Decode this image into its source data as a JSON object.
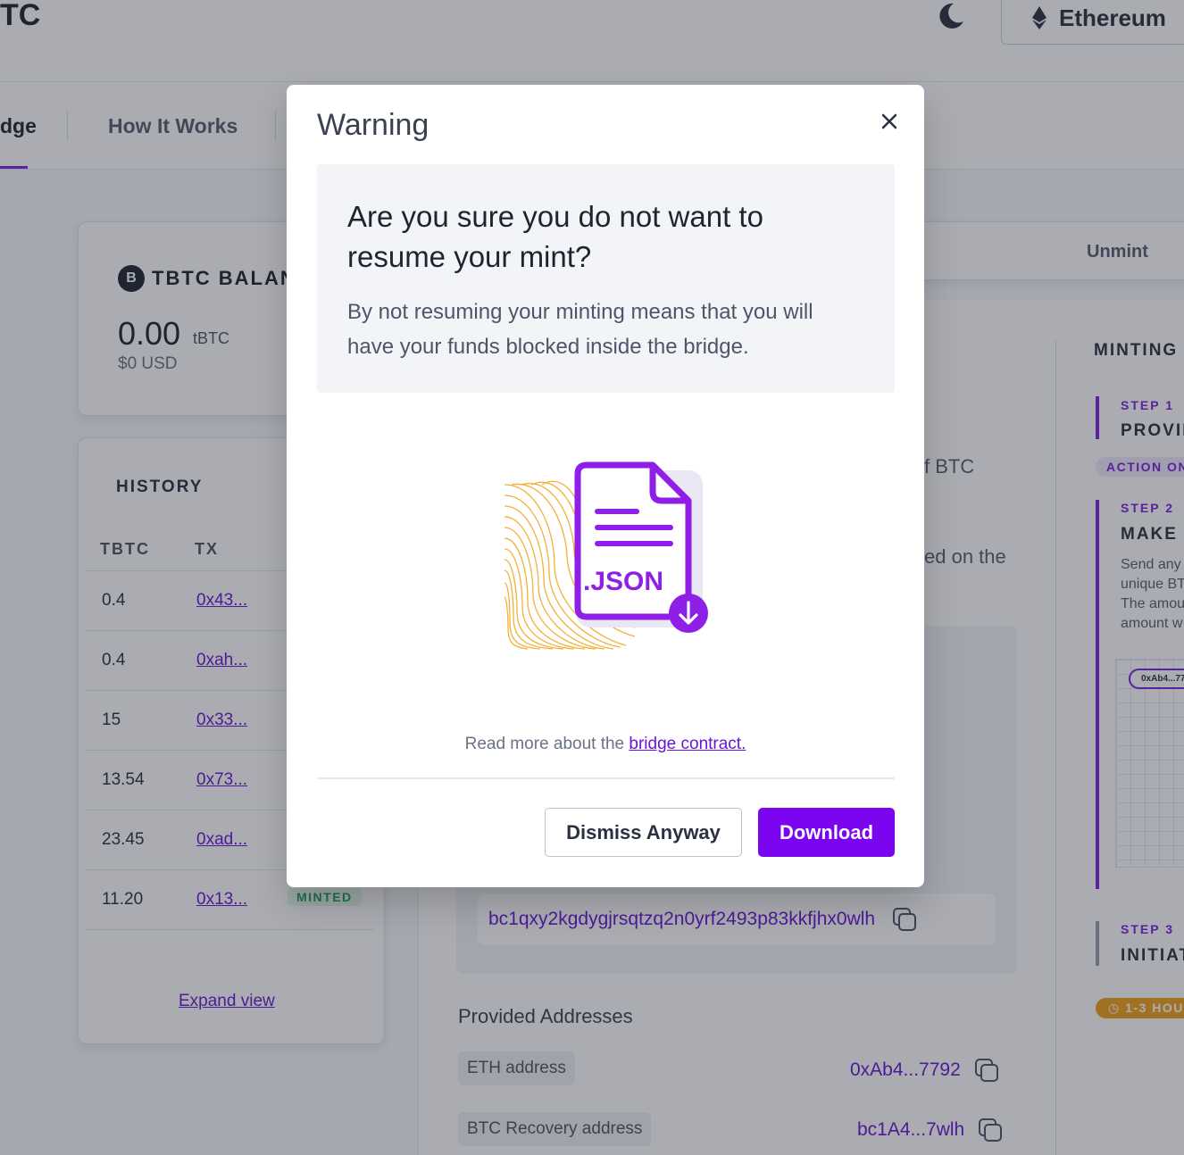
{
  "header": {
    "brand": "TC",
    "network_label": "Ethereum"
  },
  "nav": {
    "tabs": [
      {
        "label": "dge"
      },
      {
        "label": "How It Works"
      }
    ]
  },
  "balance": {
    "title": "TBTC BALAN",
    "logo_glyph": "B",
    "amount": "0.00",
    "unit": "tBTC",
    "usd": "$0 USD"
  },
  "history": {
    "title": "HISTORY",
    "columns": [
      "TBTC",
      "TX"
    ],
    "rows": [
      {
        "amount": "0.4",
        "tx": "0x43..."
      },
      {
        "amount": "0.4",
        "tx": "0xah..."
      },
      {
        "amount": "15",
        "tx": "0x33..."
      },
      {
        "amount": "13.54",
        "tx": "0x73..."
      },
      {
        "amount": "23.45",
        "tx": "0xad..."
      },
      {
        "amount": "11.20",
        "tx": "0x13...",
        "status": "MINTED"
      }
    ],
    "expand_label": "Expand view"
  },
  "mint_tabs": {
    "unmint_label": "Unmint"
  },
  "main": {
    "text_btc": "f BTC",
    "text_on_the": "ed on the",
    "btc_deposit_address": "bc1qxy2kgdygjrsqtzq2n0yrf2493p83kkfjhx0wlh",
    "provided_title": "Provided Addresses",
    "provided": [
      {
        "label": "ETH address",
        "value": "0xAb4...7792"
      },
      {
        "label": "BTC Recovery address",
        "value": "bc1A4...7wlh"
      }
    ]
  },
  "steps": {
    "title": "MINTING",
    "step1": {
      "label": "STEP 1",
      "name": "PROVID",
      "tag": "ACTION ON"
    },
    "step2": {
      "label": "STEP 2",
      "name": "MAKE A",
      "desc": [
        "Send any",
        "unique BT",
        "The amou",
        "amount w"
      ],
      "diagram_pill": "0xAb4...77"
    },
    "step3": {
      "label": "STEP 3",
      "name": "INITIAT",
      "duration": "1-3 HOU"
    }
  },
  "modal": {
    "title": "Warning",
    "heading": "Are you sure you do not want to resume your mint?",
    "body": "By not resuming your minting means that you will have your funds blocked inside the bridge.",
    "file_label": ".JSON",
    "readmore_text": "Read more about the ",
    "readmore_link": "bridge contract.",
    "dismiss_label": "Dismiss Anyway",
    "download_label": "Download"
  },
  "colors": {
    "accent": "#7b05ee",
    "link": "#6a16d6",
    "minted_badge": "#1f9e5a",
    "duration_badge": "#f0a21b"
  },
  "icons": [
    "moon-icon",
    "ethereum-icon",
    "tbtc-logo",
    "close-icon",
    "copy-icon",
    "json-file-icon",
    "download-arrow-icon",
    "clock-icon"
  ]
}
